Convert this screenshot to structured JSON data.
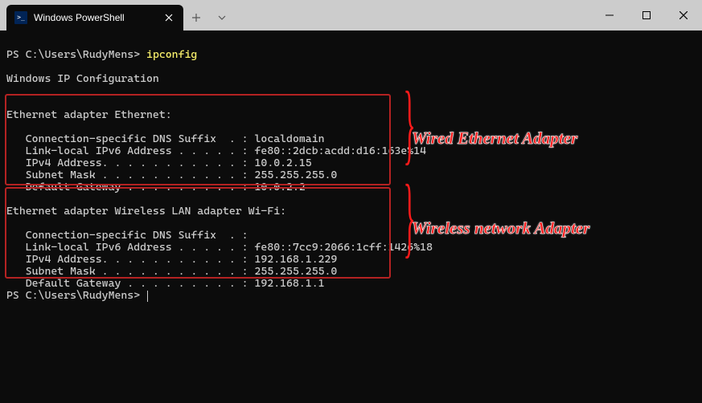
{
  "tab": {
    "title": "Windows PowerShell"
  },
  "prompt1": {
    "path": "PS C:\\Users\\RudyMens> ",
    "command": "ipconfig"
  },
  "output": {
    "header": "Windows IP Configuration",
    "adapter1": {
      "title": "Ethernet adapter Ethernet:",
      "line1": "   Connection-specific DNS Suffix  . : localdomain",
      "line2": "   Link-local IPv6 Address . . . . . : fe80::2dcb:acdd:d16:163e%14",
      "line3": "   IPv4 Address. . . . . . . . . . . : 10.0.2.15",
      "line4": "   Subnet Mask . . . . . . . . . . . : 255.255.255.0",
      "line5": "   Default Gateway . . . . . . . . . : 10.0.2.2"
    },
    "adapter2": {
      "title": "Ethernet adapter Wireless LAN adapter Wi-Fi:",
      "line1": "   Connection-specific DNS Suffix  . :",
      "line2": "   Link-local IPv6 Address . . . . . : fe80::7cc9:2066:1cff:1426%18",
      "line3": "   IPv4 Address. . . . . . . . . . . : 192.168.1.229",
      "line4": "   Subnet Mask . . . . . . . . . . . : 255.255.255.0",
      "line5": "   Default Gateway . . . . . . . . . : 192.168.1.1"
    }
  },
  "prompt2": {
    "path": "PS C:\\Users\\RudyMens> "
  },
  "annotations": {
    "wired": "Wired Ethernet Adapter",
    "wireless": "Wireless network Adapter"
  }
}
